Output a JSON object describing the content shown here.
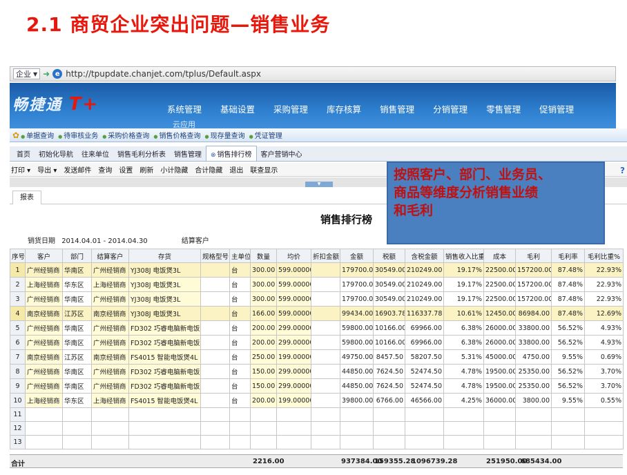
{
  "slide_title": "2.1 商贸企业突出问题—销售业务",
  "browser": {
    "favorites_label": "企业",
    "url": "http://tpupdate.chanjet.com/tplus/Default.aspx"
  },
  "app": {
    "logo_text": "畅捷通",
    "logo_suffix": "T+",
    "main_menu": [
      "系统管理",
      "基础设置",
      "采购管理",
      "库存核算",
      "销售管理",
      "分销管理",
      "零售管理",
      "促销管理"
    ],
    "sub_app": "云应用"
  },
  "quick_bar": [
    "单据查询",
    "待审核业务",
    "采购价格查询",
    "销售价格查询",
    "现存量查询",
    "凭证管理"
  ],
  "tabs": [
    "首页",
    "初始化导航",
    "往来单位",
    "销售毛利分析表",
    "销售管理",
    "销售排行榜",
    "客户营销中心"
  ],
  "toolbar": [
    "打印",
    "导出",
    "发送邮件",
    "查询",
    "设置",
    "刷新",
    "小计隐藏",
    "合计隐藏",
    "退出",
    "联查显示"
  ],
  "overlay_text": [
    "按照客户、部门、业务员、",
    "商品等维度分析销售业绩",
    "和毛利"
  ],
  "report_tab": "报表",
  "report_title": "销售排行榜",
  "info": {
    "date_label": "销货日期",
    "date_range": "2014.04.01 - 2014.04.30",
    "customer_label": "结算客户"
  },
  "columns": [
    "序号",
    "客户",
    "部门",
    "结算客户",
    "存货",
    "规格型号",
    "主单位",
    "数量",
    "均价",
    "折扣金额",
    "金额",
    "税额",
    "含税金额",
    "销售收入比重%",
    "成本",
    "毛利",
    "毛利率",
    "毛利比重%"
  ],
  "rows": [
    [
      "1",
      "广州经销商",
      "华南区",
      "广州经销商",
      "YJ308J 电饭煲3L",
      "",
      "台",
      "300.00",
      "599.000000",
      "",
      "179700.00",
      "30549.00",
      "210249.00",
      "19.17%",
      "22500.00",
      "157200.00",
      "87.48%",
      "22.93%"
    ],
    [
      "2",
      "上海经销商",
      "华东区",
      "上海经销商",
      "YJ308J 电饭煲3L",
      "",
      "台",
      "300.00",
      "599.000000",
      "",
      "179700.00",
      "30549.00",
      "210249.00",
      "19.17%",
      "22500.00",
      "157200.00",
      "87.48%",
      "22.93%"
    ],
    [
      "3",
      "广州经销商",
      "华南区",
      "广州经销商",
      "YJ308J 电饭煲3L",
      "",
      "台",
      "300.00",
      "599.000000",
      "",
      "179700.00",
      "30549.00",
      "210249.00",
      "19.17%",
      "22500.00",
      "157200.00",
      "87.48%",
      "22.93%"
    ],
    [
      "4",
      "南京经销商",
      "江苏区",
      "南京经销商",
      "YJ308J 电饭煲3L",
      "",
      "台",
      "166.00",
      "599.000000",
      "",
      "99434.00",
      "16903.78",
      "116337.78",
      "10.61%",
      "12450.00",
      "86984.00",
      "87.48%",
      "12.69%"
    ],
    [
      "5",
      "广州经销商",
      "华南区",
      "广州经销商",
      "FD302 巧睿电脑新电饭煲4L",
      "",
      "台",
      "200.00",
      "299.000000",
      "",
      "59800.00",
      "10166.00",
      "69966.00",
      "6.38%",
      "26000.00",
      "33800.00",
      "56.52%",
      "4.93%"
    ],
    [
      "6",
      "广州经销商",
      "华南区",
      "广州经销商",
      "FD302 巧睿电脑新电饭煲4L",
      "",
      "台",
      "200.00",
      "299.000000",
      "",
      "59800.00",
      "10166.00",
      "69966.00",
      "6.38%",
      "26000.00",
      "33800.00",
      "56.52%",
      "4.93%"
    ],
    [
      "7",
      "南京经销商",
      "江苏区",
      "南京经销商",
      "FS4015 智能电饭煲4L",
      "",
      "台",
      "250.00",
      "199.000000",
      "",
      "49750.00",
      "8457.50",
      "58207.50",
      "5.31%",
      "45000.00",
      "4750.00",
      "9.55%",
      "0.69%"
    ],
    [
      "8",
      "广州经销商",
      "华南区",
      "广州经销商",
      "FD302 巧睿电脑新电饭煲4L",
      "",
      "台",
      "150.00",
      "299.000000",
      "",
      "44850.00",
      "7624.50",
      "52474.50",
      "4.78%",
      "19500.00",
      "25350.00",
      "56.52%",
      "3.70%"
    ],
    [
      "9",
      "广州经销商",
      "华南区",
      "广州经销商",
      "FD302 巧睿电脑新电饭煲4L",
      "",
      "台",
      "150.00",
      "299.000000",
      "",
      "44850.00",
      "7624.50",
      "52474.50",
      "4.78%",
      "19500.00",
      "25350.00",
      "56.52%",
      "3.70%"
    ],
    [
      "10",
      "上海经销商",
      "华东区",
      "上海经销商",
      "FS4015 智能电饭煲4L",
      "",
      "台",
      "200.00",
      "199.000000",
      "",
      "39800.00",
      "6766.00",
      "46566.00",
      "4.25%",
      "36000.00",
      "3800.00",
      "9.55%",
      "0.55%"
    ]
  ],
  "empty_row_numbers": [
    "11",
    "12",
    "13"
  ],
  "totals": {
    "label": "合计",
    "quantity": "2216.00",
    "amount": "937384.00",
    "tax": "159355.28",
    "amount_with_tax": "1096739.28",
    "cost": "251950.00",
    "gross_profit": "685434.00"
  },
  "colors": {
    "title_red": "#e8170c",
    "header_blue": "#2e7fcf",
    "overlay_blue": "#4a7fc0",
    "highlight_row": "#fbf3c4"
  }
}
